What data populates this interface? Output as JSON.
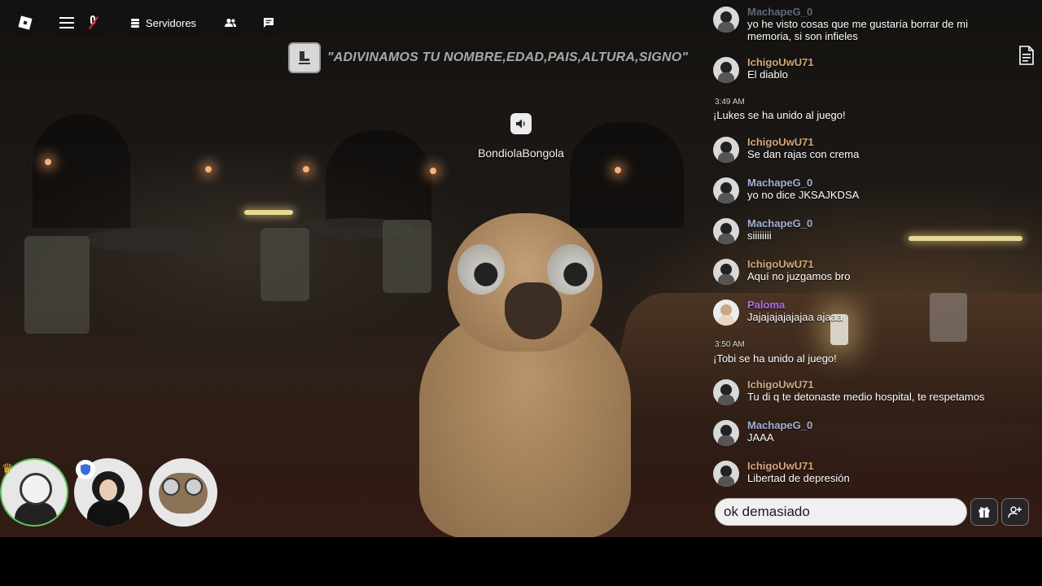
{
  "topbar": {
    "servers_label": "Servidores"
  },
  "banner": {
    "text": "\"ADIVINAMOS TU NOMBRE,EDAD,PAIS,ALTURA,SIGNO\""
  },
  "player": {
    "name": "BondiolaBongola"
  },
  "chat": {
    "messages": [
      {
        "user": "MachapeG_0",
        "text": "yo he visto cosas que me gustaría borrar de mi",
        "text2": "memoria, si son infieles"
      },
      {
        "user": "IchigoUwU71",
        "text": "El diablo"
      },
      {
        "time": "3:49 AM",
        "system": "¡Lukes se ha unido al juego!"
      },
      {
        "user": "IchigoUwU71",
        "text": "Se dan rajas con crema"
      },
      {
        "user": "MachapeG_0",
        "text": "yo no dice JKSAJKDSA"
      },
      {
        "user": "MachapeG_0",
        "text": "siiiiiiii"
      },
      {
        "user": "IchigoUwU71",
        "text": "Aquí no juzgamos bro"
      },
      {
        "user": "Paloma",
        "text": "Jajajajajajajaa ajaaa"
      },
      {
        "time": "3:50 AM",
        "system": "¡Tobi se ha unido al juego!"
      },
      {
        "user": "IchigoUwU71",
        "text": "Tu di q te detonaste medio hospital, te respetamos"
      },
      {
        "user": "MachapeG_0",
        "text": "JAAA"
      },
      {
        "user": "IchigoUwU71",
        "text": "Libertad de depresión"
      }
    ],
    "input_value": "ok demasiado"
  },
  "colors": {
    "ichigo": "#d3a679",
    "machape": "#a3b0d6",
    "paloma": "#b26fe8",
    "mic_muted": "#e4273e",
    "speaking_ring": "#56c75a"
  },
  "icons": [
    "roblox-logo-icon",
    "hamburger-menu-icon",
    "mic-muted-icon",
    "server-list-icon",
    "friends-icon",
    "chat-icon",
    "seat-icon",
    "speaker-icon",
    "crown-icon",
    "shield-icon",
    "gift-icon",
    "add-friend-icon",
    "document-icon"
  ]
}
